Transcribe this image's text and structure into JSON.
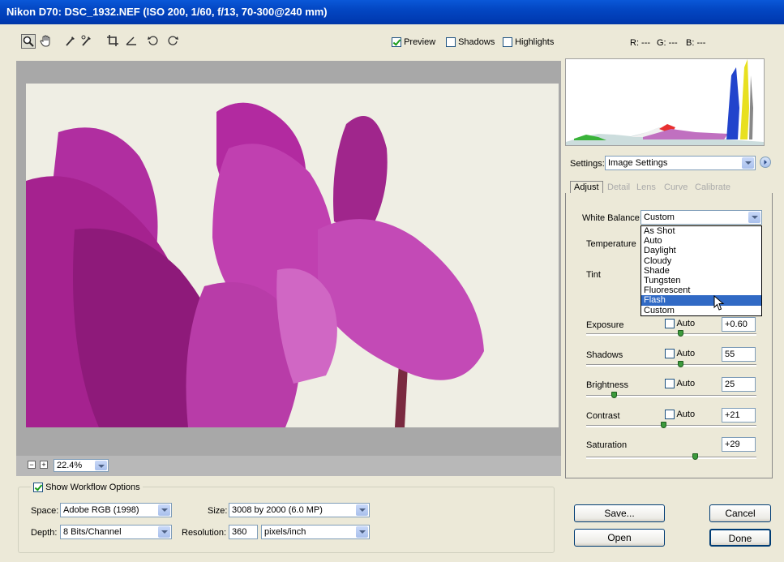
{
  "window": {
    "title": "Nikon D70:  DSC_1932.NEF  (ISO 200, 1/60, f/13, 70-300@240 mm)"
  },
  "toolbar": {
    "tools": [
      "zoom-tool",
      "hand-tool",
      "white-balance-tool",
      "color-sampler-tool",
      "crop-tool",
      "straighten-tool",
      "rotate-left-tool",
      "rotate-right-tool"
    ],
    "preview": {
      "label": "Preview",
      "checked": true
    },
    "shadows": {
      "label": "Shadows",
      "checked": false
    },
    "highlights": {
      "label": "Highlights",
      "checked": false
    }
  },
  "rgb": {
    "r": "R: ---",
    "g": "G: ---",
    "b": "B: ---"
  },
  "zoom": {
    "value": "22.4%"
  },
  "workflow": {
    "show_label": "Show Workflow Options",
    "space_label": "Space:",
    "space_value": "Adobe RGB (1998)",
    "depth_label": "Depth:",
    "depth_value": "8 Bits/Channel",
    "size_label": "Size:",
    "size_value": "3008 by 2000 (6.0 MP)",
    "resolution_label": "Resolution:",
    "resolution_value": "360",
    "resolution_unit": "pixels/inch"
  },
  "settings": {
    "label": "Settings:",
    "value": "Image Settings"
  },
  "tabs": [
    "Adjust",
    "Detail",
    "Lens",
    "Curve",
    "Calibrate"
  ],
  "adjust": {
    "white_balance_label": "White Balance:",
    "white_balance_value": "Custom",
    "wb_options": [
      "As Shot",
      "Auto",
      "Daylight",
      "Cloudy",
      "Shade",
      "Tungsten",
      "Fluorescent",
      "Flash",
      "Custom"
    ],
    "wb_highlighted": "Flash",
    "temperature_label": "Temperature",
    "tint_label": "Tint",
    "auto_label": "Auto",
    "exposure": {
      "label": "Exposure",
      "value": "+0.60",
      "level": 0.55
    },
    "shadows": {
      "label": "Shadows",
      "value": "55",
      "level": 0.55
    },
    "brightness": {
      "label": "Brightness",
      "value": "25",
      "level": 0.16
    },
    "contrast": {
      "label": "Contrast",
      "value": "+21",
      "level": 0.45
    },
    "saturation": {
      "label": "Saturation",
      "value": "+29",
      "level": 0.64
    }
  },
  "buttons": {
    "save": "Save...",
    "cancel": "Cancel",
    "open": "Open",
    "done": "Done"
  }
}
